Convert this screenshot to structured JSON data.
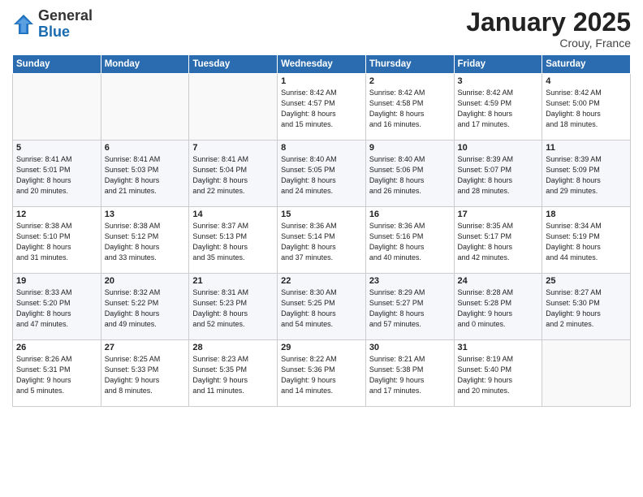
{
  "logo": {
    "general": "General",
    "blue": "Blue"
  },
  "header": {
    "month_year": "January 2025",
    "location": "Crouy, France"
  },
  "weekdays": [
    "Sunday",
    "Monday",
    "Tuesday",
    "Wednesday",
    "Thursday",
    "Friday",
    "Saturday"
  ],
  "weeks": [
    [
      {
        "day": "",
        "info": ""
      },
      {
        "day": "",
        "info": ""
      },
      {
        "day": "",
        "info": ""
      },
      {
        "day": "1",
        "info": "Sunrise: 8:42 AM\nSunset: 4:57 PM\nDaylight: 8 hours\nand 15 minutes."
      },
      {
        "day": "2",
        "info": "Sunrise: 8:42 AM\nSunset: 4:58 PM\nDaylight: 8 hours\nand 16 minutes."
      },
      {
        "day": "3",
        "info": "Sunrise: 8:42 AM\nSunset: 4:59 PM\nDaylight: 8 hours\nand 17 minutes."
      },
      {
        "day": "4",
        "info": "Sunrise: 8:42 AM\nSunset: 5:00 PM\nDaylight: 8 hours\nand 18 minutes."
      }
    ],
    [
      {
        "day": "5",
        "info": "Sunrise: 8:41 AM\nSunset: 5:01 PM\nDaylight: 8 hours\nand 20 minutes."
      },
      {
        "day": "6",
        "info": "Sunrise: 8:41 AM\nSunset: 5:03 PM\nDaylight: 8 hours\nand 21 minutes."
      },
      {
        "day": "7",
        "info": "Sunrise: 8:41 AM\nSunset: 5:04 PM\nDaylight: 8 hours\nand 22 minutes."
      },
      {
        "day": "8",
        "info": "Sunrise: 8:40 AM\nSunset: 5:05 PM\nDaylight: 8 hours\nand 24 minutes."
      },
      {
        "day": "9",
        "info": "Sunrise: 8:40 AM\nSunset: 5:06 PM\nDaylight: 8 hours\nand 26 minutes."
      },
      {
        "day": "10",
        "info": "Sunrise: 8:39 AM\nSunset: 5:07 PM\nDaylight: 8 hours\nand 28 minutes."
      },
      {
        "day": "11",
        "info": "Sunrise: 8:39 AM\nSunset: 5:09 PM\nDaylight: 8 hours\nand 29 minutes."
      }
    ],
    [
      {
        "day": "12",
        "info": "Sunrise: 8:38 AM\nSunset: 5:10 PM\nDaylight: 8 hours\nand 31 minutes."
      },
      {
        "day": "13",
        "info": "Sunrise: 8:38 AM\nSunset: 5:12 PM\nDaylight: 8 hours\nand 33 minutes."
      },
      {
        "day": "14",
        "info": "Sunrise: 8:37 AM\nSunset: 5:13 PM\nDaylight: 8 hours\nand 35 minutes."
      },
      {
        "day": "15",
        "info": "Sunrise: 8:36 AM\nSunset: 5:14 PM\nDaylight: 8 hours\nand 37 minutes."
      },
      {
        "day": "16",
        "info": "Sunrise: 8:36 AM\nSunset: 5:16 PM\nDaylight: 8 hours\nand 40 minutes."
      },
      {
        "day": "17",
        "info": "Sunrise: 8:35 AM\nSunset: 5:17 PM\nDaylight: 8 hours\nand 42 minutes."
      },
      {
        "day": "18",
        "info": "Sunrise: 8:34 AM\nSunset: 5:19 PM\nDaylight: 8 hours\nand 44 minutes."
      }
    ],
    [
      {
        "day": "19",
        "info": "Sunrise: 8:33 AM\nSunset: 5:20 PM\nDaylight: 8 hours\nand 47 minutes."
      },
      {
        "day": "20",
        "info": "Sunrise: 8:32 AM\nSunset: 5:22 PM\nDaylight: 8 hours\nand 49 minutes."
      },
      {
        "day": "21",
        "info": "Sunrise: 8:31 AM\nSunset: 5:23 PM\nDaylight: 8 hours\nand 52 minutes."
      },
      {
        "day": "22",
        "info": "Sunrise: 8:30 AM\nSunset: 5:25 PM\nDaylight: 8 hours\nand 54 minutes."
      },
      {
        "day": "23",
        "info": "Sunrise: 8:29 AM\nSunset: 5:27 PM\nDaylight: 8 hours\nand 57 minutes."
      },
      {
        "day": "24",
        "info": "Sunrise: 8:28 AM\nSunset: 5:28 PM\nDaylight: 9 hours\nand 0 minutes."
      },
      {
        "day": "25",
        "info": "Sunrise: 8:27 AM\nSunset: 5:30 PM\nDaylight: 9 hours\nand 2 minutes."
      }
    ],
    [
      {
        "day": "26",
        "info": "Sunrise: 8:26 AM\nSunset: 5:31 PM\nDaylight: 9 hours\nand 5 minutes."
      },
      {
        "day": "27",
        "info": "Sunrise: 8:25 AM\nSunset: 5:33 PM\nDaylight: 9 hours\nand 8 minutes."
      },
      {
        "day": "28",
        "info": "Sunrise: 8:23 AM\nSunset: 5:35 PM\nDaylight: 9 hours\nand 11 minutes."
      },
      {
        "day": "29",
        "info": "Sunrise: 8:22 AM\nSunset: 5:36 PM\nDaylight: 9 hours\nand 14 minutes."
      },
      {
        "day": "30",
        "info": "Sunrise: 8:21 AM\nSunset: 5:38 PM\nDaylight: 9 hours\nand 17 minutes."
      },
      {
        "day": "31",
        "info": "Sunrise: 8:19 AM\nSunset: 5:40 PM\nDaylight: 9 hours\nand 20 minutes."
      },
      {
        "day": "",
        "info": ""
      }
    ]
  ]
}
